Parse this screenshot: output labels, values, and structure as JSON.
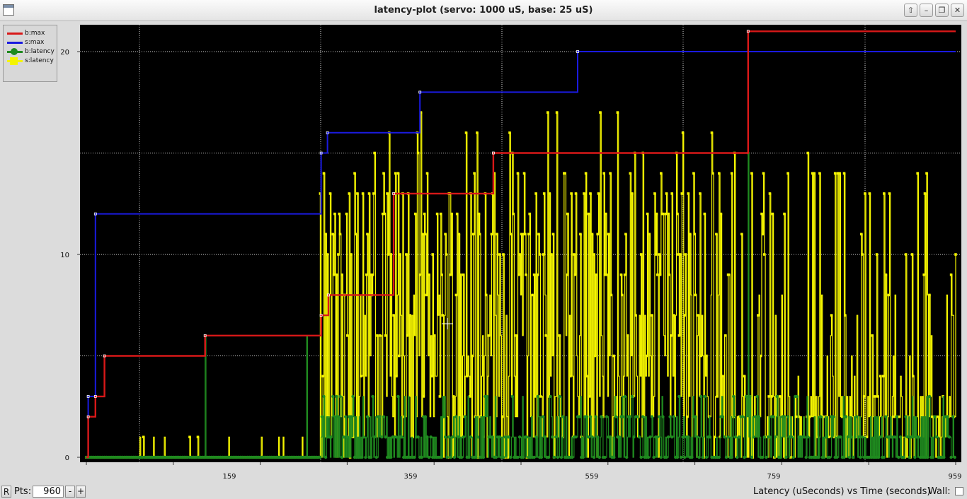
{
  "window": {
    "title": "latency-plot (servo: 1000 uS, base: 25 uS)",
    "buttons": [
      "⇧",
      "–",
      "❐",
      "✕"
    ]
  },
  "legend": [
    {
      "label": "b:max",
      "color": "#d81818",
      "marker": "line"
    },
    {
      "label": "s:max",
      "color": "#1a1ae0",
      "marker": "line"
    },
    {
      "label": "b:latency",
      "color": "#1f8a1f",
      "marker": "dot"
    },
    {
      "label": "s:latency",
      "color": "#f4f400",
      "marker": "square"
    }
  ],
  "controls": {
    "r_label": "R",
    "pts_label": "Pts:",
    "pts_value": "960",
    "minus_label": "-",
    "plus_label": "+",
    "axis_description": "Latency (uSeconds) vs Time (seconds)",
    "wall_label": "Wall:"
  },
  "chart_data": {
    "type": "line",
    "xlim": [
      0,
      959
    ],
    "ylim": [
      0,
      21
    ],
    "x_ticks": [
      159,
      359,
      559,
      759,
      959
    ],
    "y_ticks": [
      0,
      10,
      20
    ],
    "grid": true,
    "legend_position": "top-left",
    "series": [
      {
        "name": "b:max",
        "color": "#d81818",
        "steps": [
          [
            0,
            0
          ],
          [
            2,
            2
          ],
          [
            10,
            3
          ],
          [
            20,
            5
          ],
          [
            131,
            6
          ],
          [
            259,
            7
          ],
          [
            267,
            8
          ],
          [
            339,
            13
          ],
          [
            449,
            15
          ],
          [
            730,
            21
          ],
          [
            959,
            21
          ]
        ]
      },
      {
        "name": "s:max",
        "color": "#1a1ae0",
        "steps": [
          [
            0,
            0
          ],
          [
            2,
            3
          ],
          [
            10,
            12
          ],
          [
            259,
            15
          ],
          [
            266,
            16
          ],
          [
            368,
            18
          ],
          [
            542,
            20
          ],
          [
            959,
            20
          ]
        ]
      },
      {
        "name": "b:latency",
        "color": "#1f8a1f",
        "range": [
          0,
          6
        ],
        "typical": [
          0,
          3
        ]
      },
      {
        "name": "s:latency",
        "color": "#f4f400",
        "range": [
          0,
          17
        ],
        "typical": [
          0,
          15
        ]
      }
    ]
  }
}
